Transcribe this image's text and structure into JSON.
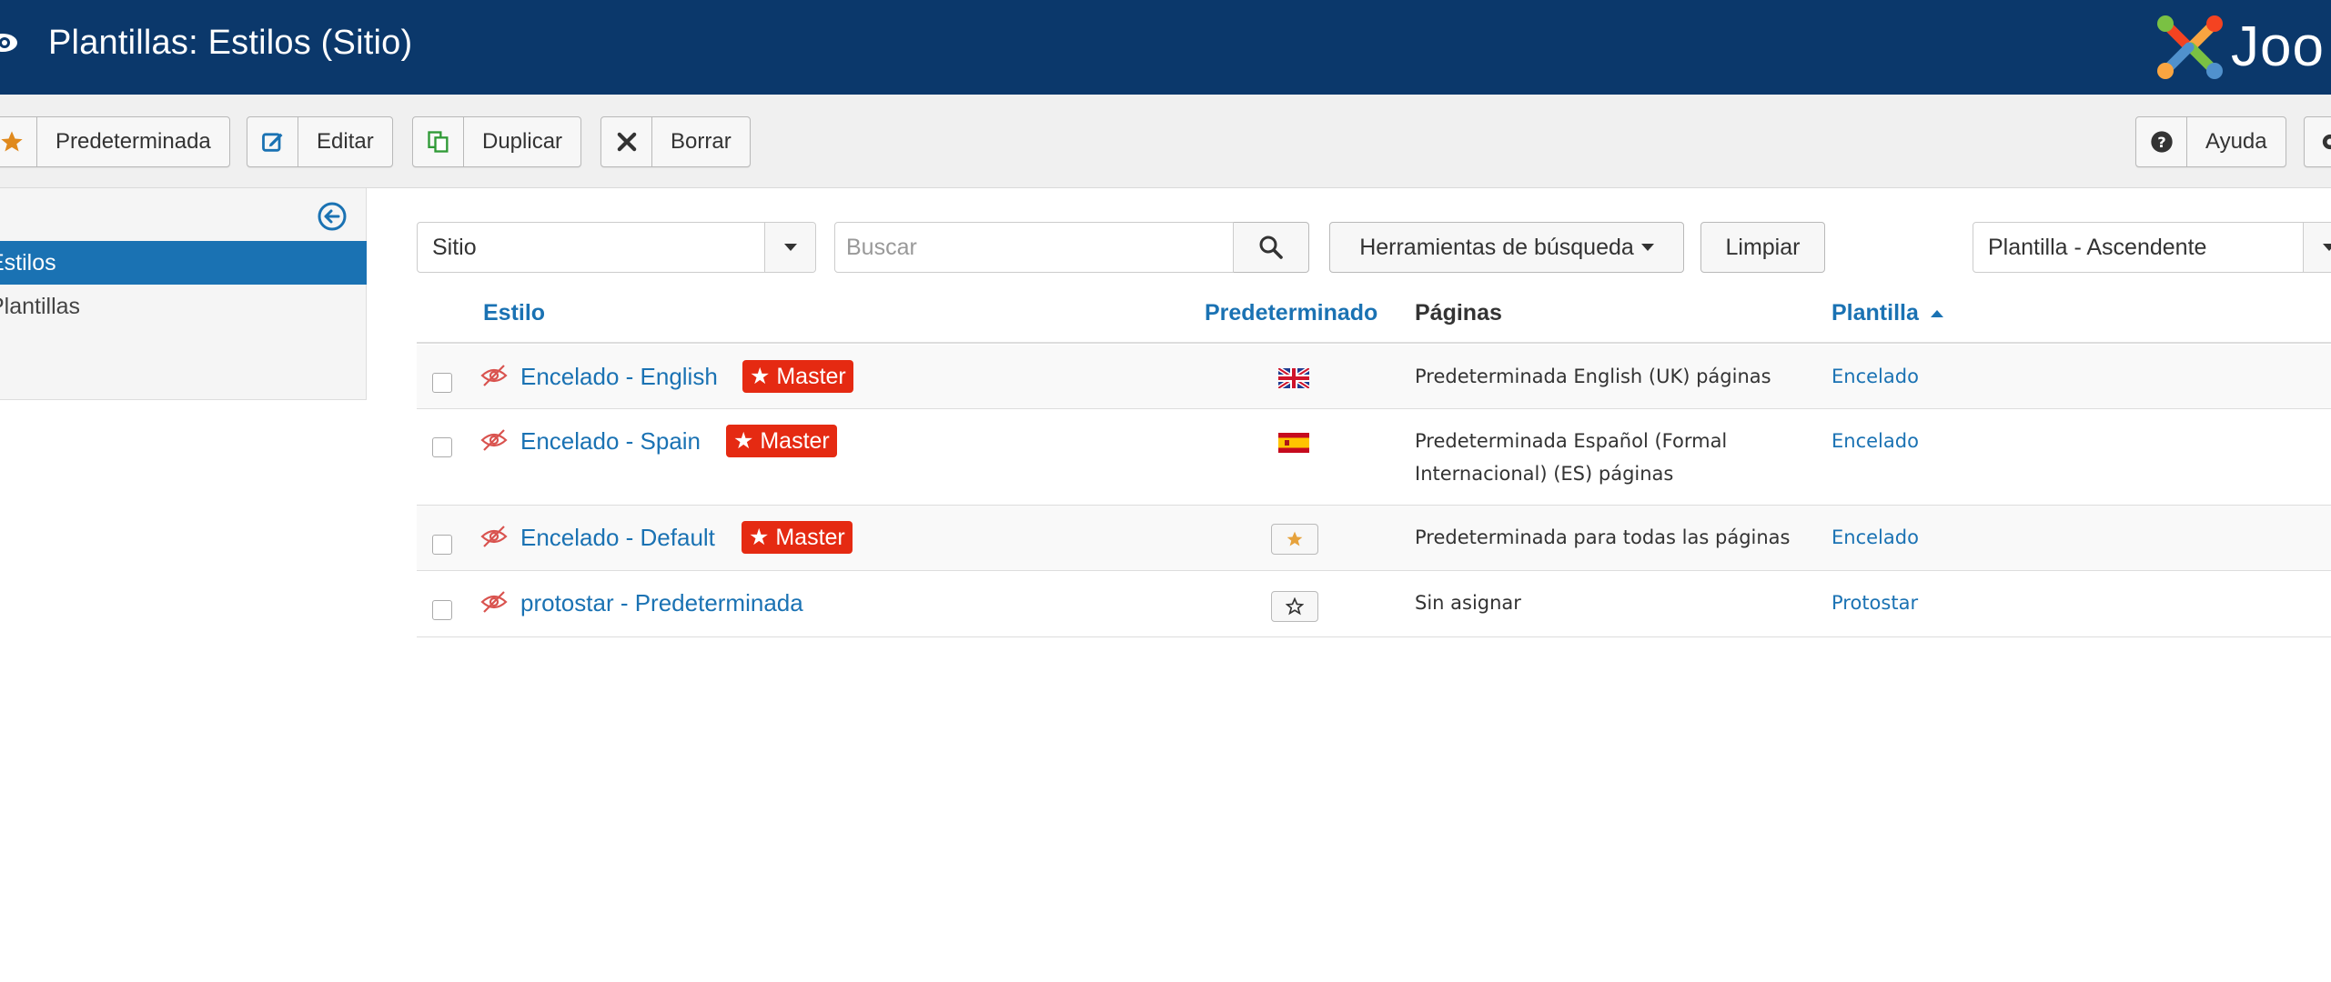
{
  "header": {
    "title": "Plantillas: Estilos (Sitio)",
    "logo_text": "Joo"
  },
  "toolbar": {
    "default_label": "Predeterminada",
    "edit_label": "Editar",
    "duplicate_label": "Duplicar",
    "delete_label": "Borrar",
    "help_label": "Ayuda"
  },
  "sidebar": {
    "items": [
      {
        "label": "Estilos",
        "active": true
      },
      {
        "label": "Plantillas",
        "active": false
      }
    ]
  },
  "filters": {
    "client_select": "Sitio",
    "search_placeholder": "Buscar",
    "search_tools_label": "Herramientas de búsqueda",
    "clear_label": "Limpiar",
    "ordering_select": "Plantilla - Ascendente"
  },
  "table": {
    "headers": {
      "style": "Estilo",
      "default": "Predeterminado",
      "pages": "Páginas",
      "template": "Plantilla"
    },
    "rows": [
      {
        "style": "Encelado - English",
        "badge": "★ Master",
        "pages_line1": "Predeterminada English (UK) páginas",
        "pages_line2": "",
        "template": "Encelado",
        "default_icon": "uk-flag-icon"
      },
      {
        "style": "Encelado - Spain",
        "badge": "★ Master",
        "pages_line1": "Predeterminada Español (Formal",
        "pages_line2": "Internacional) (ES) páginas",
        "template": "Encelado",
        "default_icon": "spain-flag-icon"
      },
      {
        "style": "Encelado - Default",
        "badge": "★ Master",
        "pages_line1": "Predeterminada para todas las páginas",
        "pages_line2": "",
        "template": "Encelado",
        "default_icon": "star-filled-icon"
      },
      {
        "style": "protostar - Predeterminada",
        "badge": "",
        "pages_line1": "Sin asignar",
        "pages_line2": "",
        "template": "Protostar",
        "default_icon": "star-outline-icon"
      }
    ]
  },
  "colors": {
    "header_bg": "#0b386b",
    "link": "#1a72b3",
    "badge": "#e52a12",
    "sidebar_active": "#1a72b3",
    "star": "#e6a23c"
  }
}
